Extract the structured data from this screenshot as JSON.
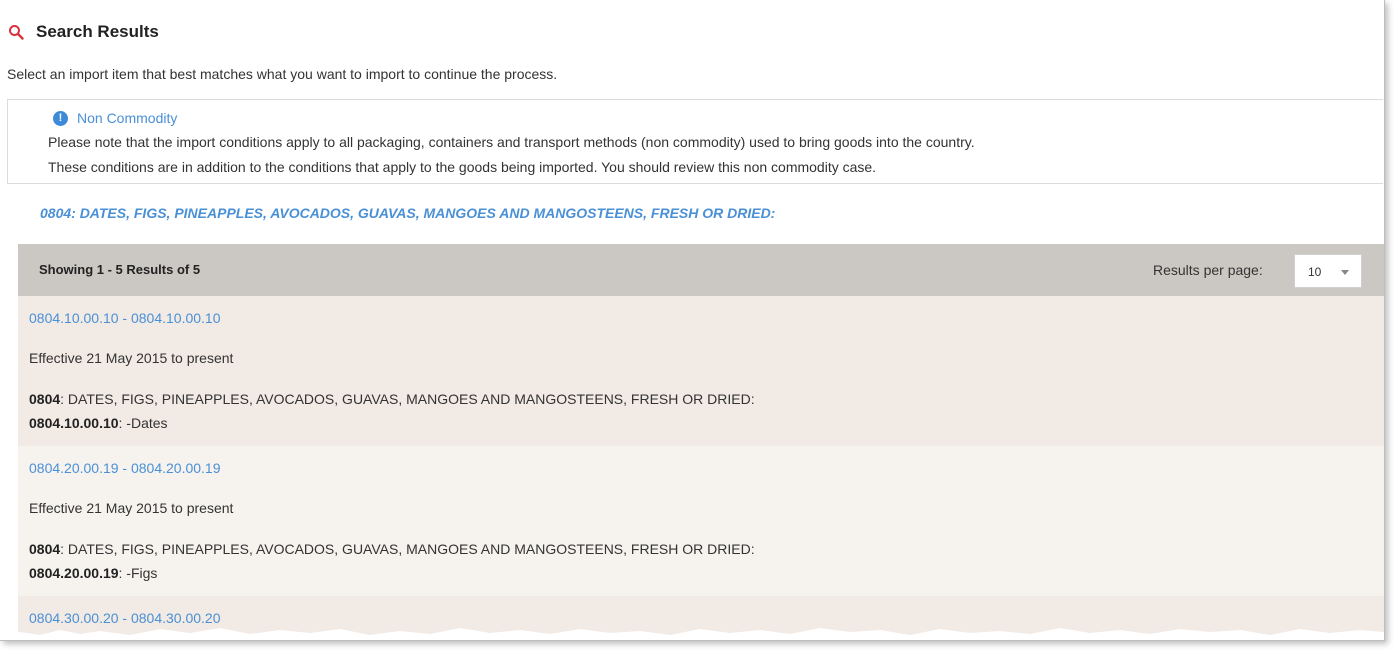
{
  "header": {
    "title": "Search Results",
    "intro": "Select an import item that best matches what you want to import to continue the process."
  },
  "notice": {
    "title": "Non Commodity",
    "line1": "Please note that the import conditions apply to all packaging, containers and transport methods (non commodity) used to bring goods into the country.",
    "line2": "These conditions are in addition to the conditions that apply to the goods being imported. You should review this non commodity case."
  },
  "heading_link": "0804: DATES, FIGS, PINEAPPLES, AVOCADOS, GUAVAS, MANGOES AND MANGOSTEENS, FRESH OR DRIED:",
  "results_bar": {
    "showing": "Showing 1 - 5 Results of 5",
    "per_page_label": "Results per page:",
    "per_page_value": "10"
  },
  "results": [
    {
      "code_range": "0804.10.00.10 - 0804.10.00.10",
      "effective": "Effective 21 May 2015 to present",
      "parent_code": "0804",
      "parent_desc": ": DATES, FIGS, PINEAPPLES, AVOCADOS, GUAVAS, MANGOES AND MANGOSTEENS, FRESH OR DRIED:",
      "item_code": "0804.10.00.10",
      "item_desc": ": -Dates"
    },
    {
      "code_range": "0804.20.00.19 - 0804.20.00.19",
      "effective": "Effective 21 May 2015 to present",
      "parent_code": "0804",
      "parent_desc": ": DATES, FIGS, PINEAPPLES, AVOCADOS, GUAVAS, MANGOES AND MANGOSTEENS, FRESH OR DRIED:",
      "item_code": "0804.20.00.19",
      "item_desc": ": -Figs"
    },
    {
      "code_range": "0804.30.00.20 - 0804.30.00.20"
    }
  ],
  "colors": {
    "link": "#4a90d6",
    "search_icon": "#d9333f",
    "bar_bg": "#cbc7c3",
    "row_odd": "#f2eae4",
    "row_even": "#f6f3ef"
  }
}
